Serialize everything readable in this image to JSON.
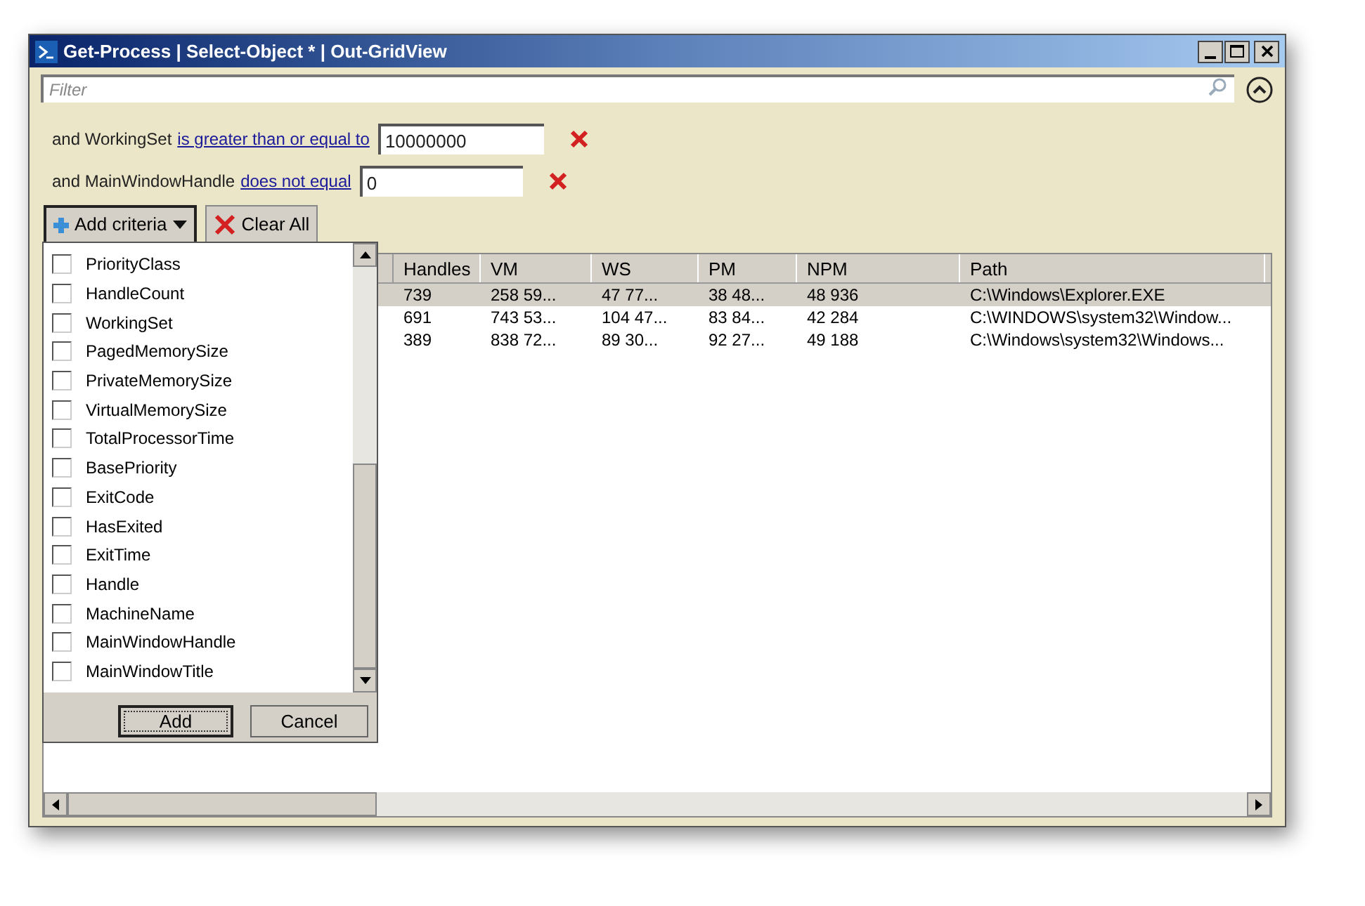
{
  "window": {
    "title": "Get-Process | Select-Object * | Out-GridView"
  },
  "filter": {
    "placeholder": "Filter"
  },
  "criteria": [
    {
      "prefix": "and WorkingSet",
      "operator": "is greater than or equal to",
      "value": "10000000"
    },
    {
      "prefix": "and MainWindowHandle",
      "operator": "does not equal",
      "value": "0"
    }
  ],
  "buttons": [
    {
      "kind": "add",
      "label": "Add criteria"
    },
    {
      "kind": "clear",
      "label": "Clear All"
    }
  ],
  "table": {
    "columns": [
      "Handles",
      "VM",
      "WS",
      "PM",
      "NPM",
      "Path"
    ],
    "rows": [
      {
        "selected": true,
        "cells": [
          "739",
          "258 59...",
          "47 77...",
          "38 48...",
          "48 936",
          "C:\\Windows\\Explorer.EXE"
        ]
      },
      {
        "selected": false,
        "cells": [
          "691",
          "743 53...",
          "104 47...",
          "83 84...",
          "42 284",
          "C:\\WINDOWS\\system32\\Window..."
        ]
      },
      {
        "selected": false,
        "cells": [
          "389",
          "838 72...",
          "89 30...",
          "92 27...",
          "49 188",
          "C:\\Windows\\system32\\Windows..."
        ]
      }
    ]
  },
  "criteria_menu": {
    "items": [
      {
        "label": "PriorityClass",
        "checked": false
      },
      {
        "label": "HandleCount",
        "checked": false
      },
      {
        "label": "WorkingSet",
        "checked": false
      },
      {
        "label": "PagedMemorySize",
        "checked": false
      },
      {
        "label": "PrivateMemorySize",
        "checked": false
      },
      {
        "label": "VirtualMemorySize",
        "checked": false
      },
      {
        "label": "TotalProcessorTime",
        "checked": false
      },
      {
        "label": "BasePriority",
        "checked": false
      },
      {
        "label": "ExitCode",
        "checked": false
      },
      {
        "label": "HasExited",
        "checked": false
      },
      {
        "label": "ExitTime",
        "checked": false
      },
      {
        "label": "Handle",
        "checked": false
      },
      {
        "label": "MachineName",
        "checked": false
      },
      {
        "label": "MainWindowHandle",
        "checked": false
      },
      {
        "label": "MainWindowTitle",
        "checked": false
      }
    ],
    "buttons": [
      "Add",
      "Cancel"
    ]
  }
}
